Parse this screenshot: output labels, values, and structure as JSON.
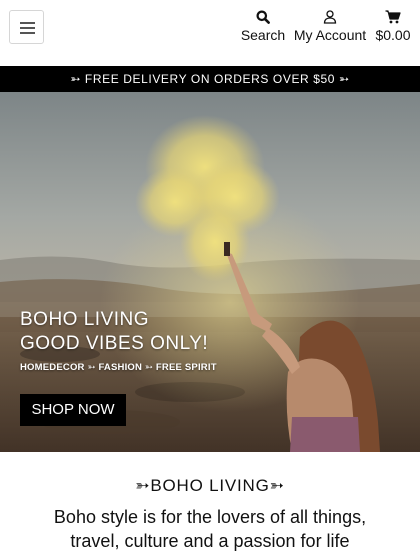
{
  "header": {
    "menu_icon": "hamburger-icon",
    "search": {
      "icon": "search-icon",
      "label": "Search"
    },
    "account": {
      "icon": "user-icon",
      "label": "My Account"
    },
    "cart": {
      "icon": "cart-icon",
      "label": "$0.00"
    }
  },
  "announcement": {
    "text": "➳ FREE DELIVERY ON ORDERS OVER $50 ➳"
  },
  "hero": {
    "title_line1": "BOHO LIVING",
    "title_line2": "GOOD VIBES ONLY!",
    "subtitle": "HOMEDECOR ➳ FASHION ➳ FREE SPIRIT",
    "button_label": "SHOP NOW"
  },
  "section": {
    "title": "➳BOHO LIVING➳",
    "text": "Boho style is for the lovers of all things, travel, culture and a passion for life"
  },
  "colors": {
    "announcement_bg": "#000000",
    "button_bg": "#000000",
    "smoke": "#e7d77a"
  }
}
